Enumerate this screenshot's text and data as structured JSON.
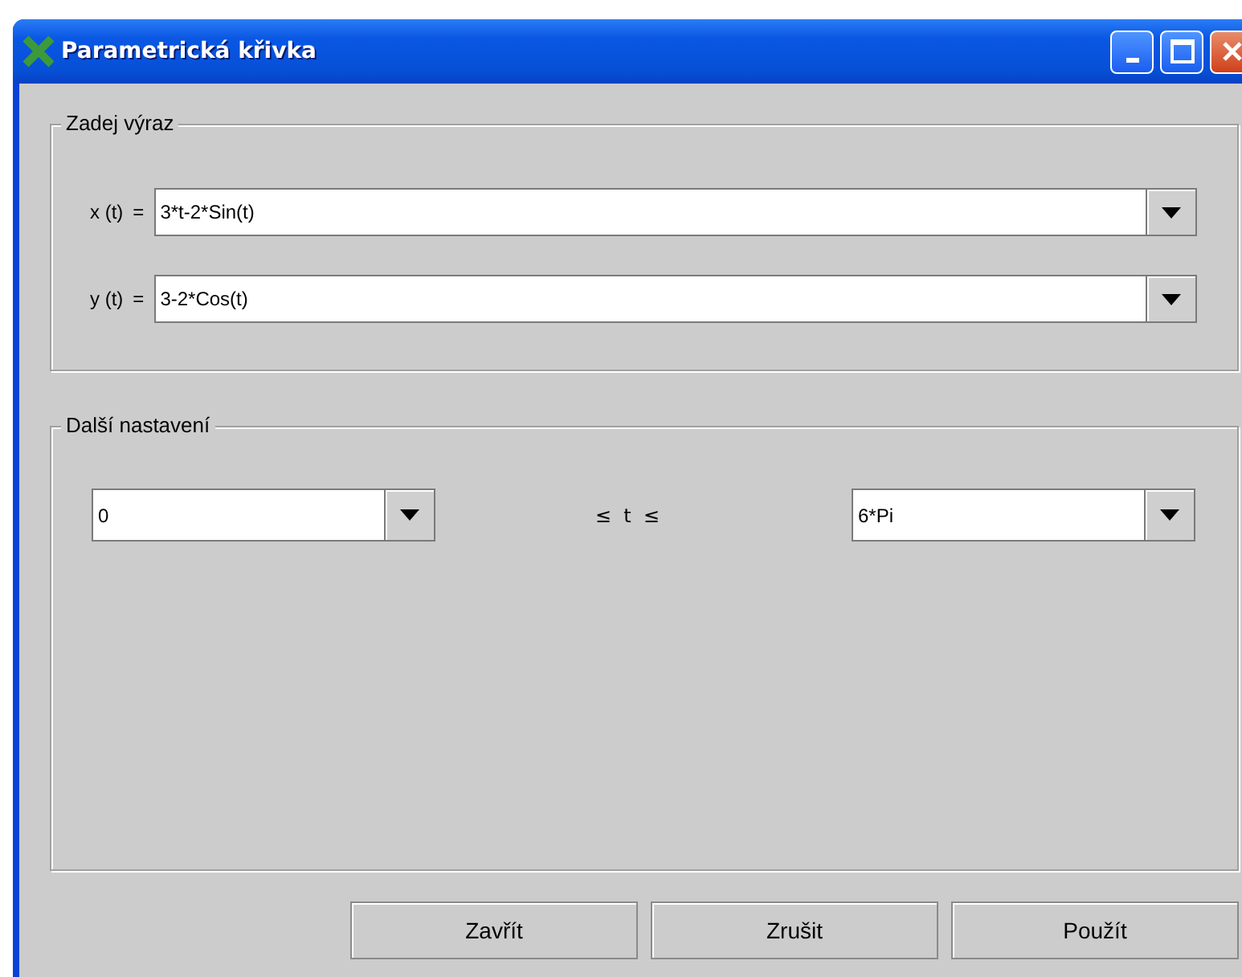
{
  "window": {
    "title": "Parametrická křivka"
  },
  "expression_group": {
    "legend": "Zadej výraz",
    "rows": [
      {
        "label": "x (t)",
        "equals": "=",
        "value": "3*t-2*Sin(t)"
      },
      {
        "label": "y (t)",
        "equals": "=",
        "value": "3-2*Cos(t)"
      }
    ]
  },
  "settings_group": {
    "legend": "Další nastavení",
    "range": {
      "from": "0",
      "relation": "≤  t  ≤",
      "to": "6*Pi"
    }
  },
  "buttons": [
    "Zavřít",
    "Zrušit",
    "Použít"
  ]
}
